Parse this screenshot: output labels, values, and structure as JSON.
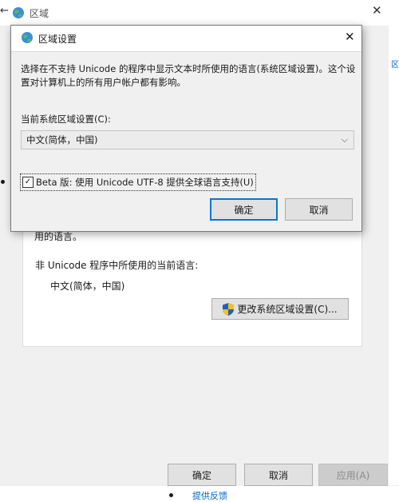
{
  "background_window": {
    "back_glyph": "←",
    "title": "区域",
    "close_glyph": "✕",
    "text_fragment": "用的语言。",
    "non_unicode_label": "非 Unicode 程序中所使用的当前语言:",
    "non_unicode_value": "中文(简体，中国)",
    "change_button_label": "更改系统区域设置(C)...",
    "buttons": {
      "ok": "确定",
      "cancel": "取消",
      "apply": "应用(A)"
    },
    "side_link_fragment": "区",
    "bottom_link_fragment": "提供反馈"
  },
  "dialog": {
    "title": "区域设置",
    "close_glyph": "✕",
    "description": "选择在不支持 Unicode 的程序中显示文本时所使用的语言(系统区域设置)。这个设置对计算机上的所有用户帐户都有影响。",
    "current_locale_label": "当前系统区域设置(C):",
    "current_locale_value": "中文(简体，中国)",
    "beta_checkbox_label": "Beta 版: 使用 Unicode UTF-8 提供全球语言支持(U)",
    "beta_checked": true,
    "check_glyph": "✓",
    "chevron_glyph": "⌵",
    "ok_label": "确定",
    "cancel_label": "取消"
  },
  "colors": {
    "accent": "#0078d7",
    "window_bg": "#f0f0f0",
    "button_bg": "#e1e1e1",
    "link": "#0066cc"
  }
}
